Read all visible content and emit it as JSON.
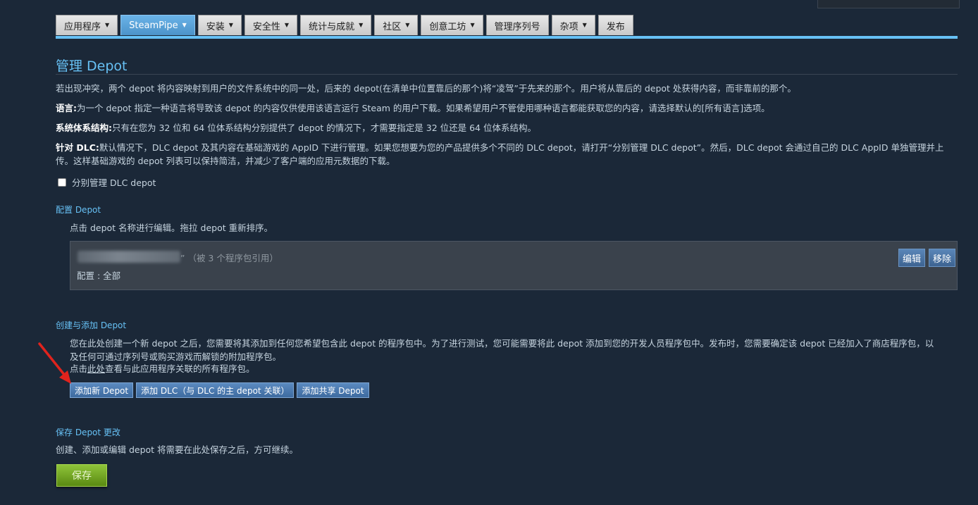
{
  "tabs": [
    {
      "label": "应用程序",
      "caret": true,
      "active": false
    },
    {
      "label": "SteamPipe",
      "caret": true,
      "active": true
    },
    {
      "label": "安装",
      "caret": true,
      "active": false
    },
    {
      "label": "安全性",
      "caret": true,
      "active": false
    },
    {
      "label": "统计与成就",
      "caret": true,
      "active": false
    },
    {
      "label": "社区",
      "caret": true,
      "active": false
    },
    {
      "label": "创意工坊",
      "caret": true,
      "active": false
    },
    {
      "label": "管理序列号",
      "caret": false,
      "active": false
    },
    {
      "label": "杂项",
      "caret": true,
      "active": false
    },
    {
      "label": "发布",
      "caret": false,
      "active": false
    }
  ],
  "page_title": "管理 Depot",
  "intro": "若出现冲突，两个 depot 将内容映射到用户的文件系统中的同一处，后来的 depot(在清单中位置靠后的那个)将“凌驾”于先来的那个。用户将从靠后的 depot 处获得内容，而非靠前的那个。",
  "lang": {
    "label": "语言:",
    "text": "为一个 depot 指定一种语言将导致该 depot 的内容仅供使用该语言运行 Steam 的用户下载。如果希望用户不管使用哪种语言都能获取您的内容，请选择默认的[所有语言]选项。"
  },
  "arch": {
    "label": "系统体系结构:",
    "text": "只有在您为 32 位和 64 位体系结构分别提供了 depot 的情况下，才需要指定是 32 位还是 64 位体系结构。"
  },
  "dlc": {
    "label": "针对 DLC:",
    "text": "默认情况下，DLC depot 及其内容在基础游戏的 AppID 下进行管理。如果您想要为您的产品提供多个不同的 DLC depot，请打开“分别管理 DLC depot”。然后，DLC depot 会通过自己的 DLC AppID 单独管理并上传。这样基础游戏的 depot 列表可以保持简洁，并减少了客户端的应用元数据的下载。"
  },
  "dlc_checkbox_label": "分别管理 DLC depot",
  "config": {
    "title": "配置 Depot",
    "hint": "点击 depot 名称进行编辑。拖拉 depot 重新排序。",
    "depot": {
      "ref": "” （被 3 个程序包引用）",
      "config": "配置 : 全部",
      "edit": "编辑",
      "remove": "移除"
    }
  },
  "create": {
    "title": "创建与添加 Depot",
    "text": "您在此处创建一个新 depot 之后，您需要将其添加到任何您希望包含此 depot 的程序包中。为了进行测试，您可能需要将此 depot 添加到您的开发人员程序包中。发布时，您需要确定该 depot 已经加入了商店程序包，以及任何可通过序列号或购买游戏而解锁的附加程序包。",
    "link_prefix": "点击",
    "link": "此处",
    "link_suffix": "查看与此应用程序关联的所有程序包。",
    "btn_new": "添加新 Depot",
    "btn_dlc": "添加 DLC（与 DLC 的主 depot 关联）",
    "btn_shared": "添加共享 Depot"
  },
  "save": {
    "title": "保存 Depot 更改",
    "text": "创建、添加或编辑 depot 将需要在此处保存之后，方可继续。",
    "button": "保存"
  },
  "colors": {
    "bg": "#1b2838",
    "accent": "#67c1f5",
    "save": "#6fa720"
  }
}
